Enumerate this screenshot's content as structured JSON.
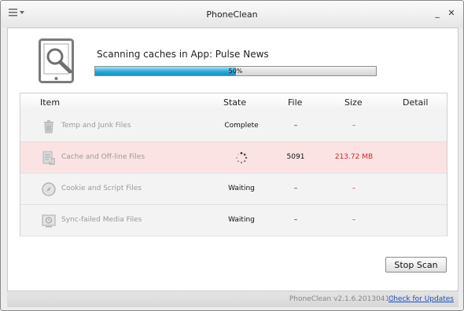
{
  "window": {
    "title": "PhoneClean"
  },
  "icons": {
    "menu": "hamburger-menu-icon",
    "minimize": "minimize-icon",
    "close": "close-icon",
    "scan": "tablet-magnifier-icon"
  },
  "scan": {
    "title": "Scanning caches in App: Pulse News",
    "progress_value": 0.5,
    "progress_label": "50%"
  },
  "table": {
    "columns": [
      "Item",
      "State",
      "File",
      "Size",
      "Detail"
    ],
    "rows": [
      {
        "name": "Temp and Junk Files",
        "icon": "trash-bin-icon",
        "state": "Complete",
        "file": "–",
        "size": "–",
        "active": false
      },
      {
        "name": "Cache and Off-line Files",
        "icon": "document-cache-icon",
        "state": "",
        "state_icon": "spinner-icon",
        "file": "5091",
        "size": "213.72 MB",
        "active": true
      },
      {
        "name": "Cookie and Script Files",
        "icon": "compass-icon",
        "state": "Waiting",
        "file": "–",
        "size": "–",
        "active": false
      },
      {
        "name": "Sync-failed Media Files",
        "icon": "media-sync-icon",
        "state": "Waiting",
        "file": "–",
        "size": "–",
        "active": false
      }
    ]
  },
  "buttons": {
    "stop_scan": "Stop Scan"
  },
  "status": {
    "version": "PhoneClean v2.1.6.20130413",
    "check_updates": "Check for Updates"
  },
  "colors": {
    "progress_blue": "#2aa9d8",
    "active_row": "#fbe3e3",
    "size_red": "#d42222",
    "link_blue": "#1a4fc0"
  }
}
